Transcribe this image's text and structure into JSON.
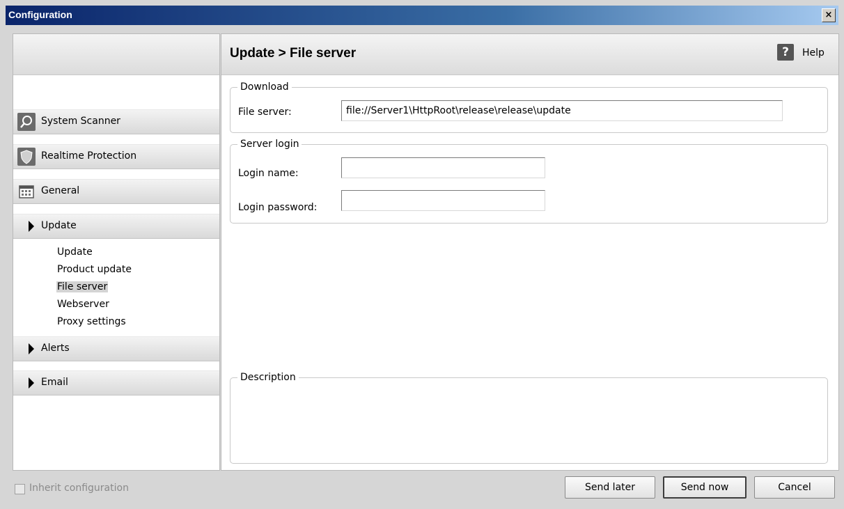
{
  "window": {
    "title": "Configuration",
    "close_glyph": "×"
  },
  "header": {
    "title": "Update > File server",
    "help_label": "Help",
    "help_icon": "question-icon"
  },
  "nav": {
    "items": [
      {
        "label": "System Scanner",
        "icon": "search-icon"
      },
      {
        "label": "Realtime Protection",
        "icon": "shield-icon"
      },
      {
        "label": "General",
        "icon": "calendar-icon"
      },
      {
        "label": "Update",
        "icon": "arrow-right-icon"
      },
      {
        "label": "Alerts",
        "icon": "arrow-right-icon"
      },
      {
        "label": "Email",
        "icon": "arrow-right-icon"
      }
    ],
    "update_subitems": [
      "Update",
      "Product update",
      "File server",
      "Webserver",
      "Proxy settings"
    ],
    "selected_subitem": "File server"
  },
  "download": {
    "legend": "Download",
    "file_server_label": "File server:",
    "file_server_value": "file://Server1\\HttpRoot\\release\\release\\update"
  },
  "server_login": {
    "legend": "Server login",
    "login_name_label": "Login name:",
    "login_name_value": "",
    "login_password_label": "Login password:",
    "login_password_value": ""
  },
  "description": {
    "legend": "Description"
  },
  "footer": {
    "inherit_label": "Inherit configuration",
    "inherit_checked": false,
    "send_later": "Send later",
    "send_now": "Send now",
    "cancel": "Cancel"
  }
}
